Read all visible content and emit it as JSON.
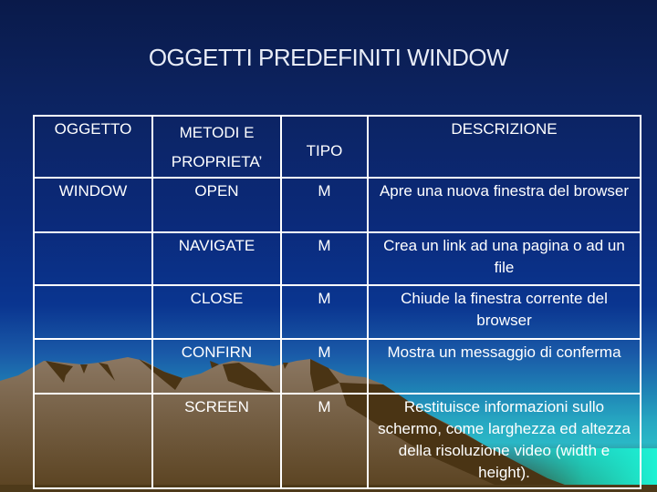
{
  "slide": {
    "title": "OGGETTI PREDEFINITI WINDOW"
  },
  "table": {
    "headers": {
      "oggetto": "OGGETTO",
      "metodi_line1": "METODI E",
      "metodi_line2": "PROPRIETA’",
      "tipo": "TIPO",
      "descrizione": "DESCRIZIONE"
    },
    "rows": [
      {
        "oggetto": "WINDOW",
        "metodo": "OPEN",
        "tipo": "M",
        "descrizione": "Apre una nuova finestra del browser"
      },
      {
        "oggetto": "",
        "metodo": "NAVIGATE",
        "tipo": "M",
        "descrizione": "Crea un link ad una pagina o ad un file"
      },
      {
        "oggetto": "",
        "metodo": "CLOSE",
        "tipo": "M",
        "descrizione": "Chiude la finestra corrente del browser"
      },
      {
        "oggetto": "",
        "metodo": "CONFIRN",
        "tipo": "M",
        "descrizione": "Mostra un messaggio di conferma"
      },
      {
        "oggetto": "",
        "metodo": "SCREEN",
        "tipo": "M",
        "descrizione": "Restituisce informazioni sullo schermo, come larghezza ed altezza della risoluzione video (width e height)."
      }
    ]
  },
  "theme": {
    "text_color": "#ffffff",
    "border_color": "#ffffff",
    "mountain_light": "#8a7560",
    "mountain_dark": "#4a3414",
    "water_color": "#19e6cc"
  }
}
